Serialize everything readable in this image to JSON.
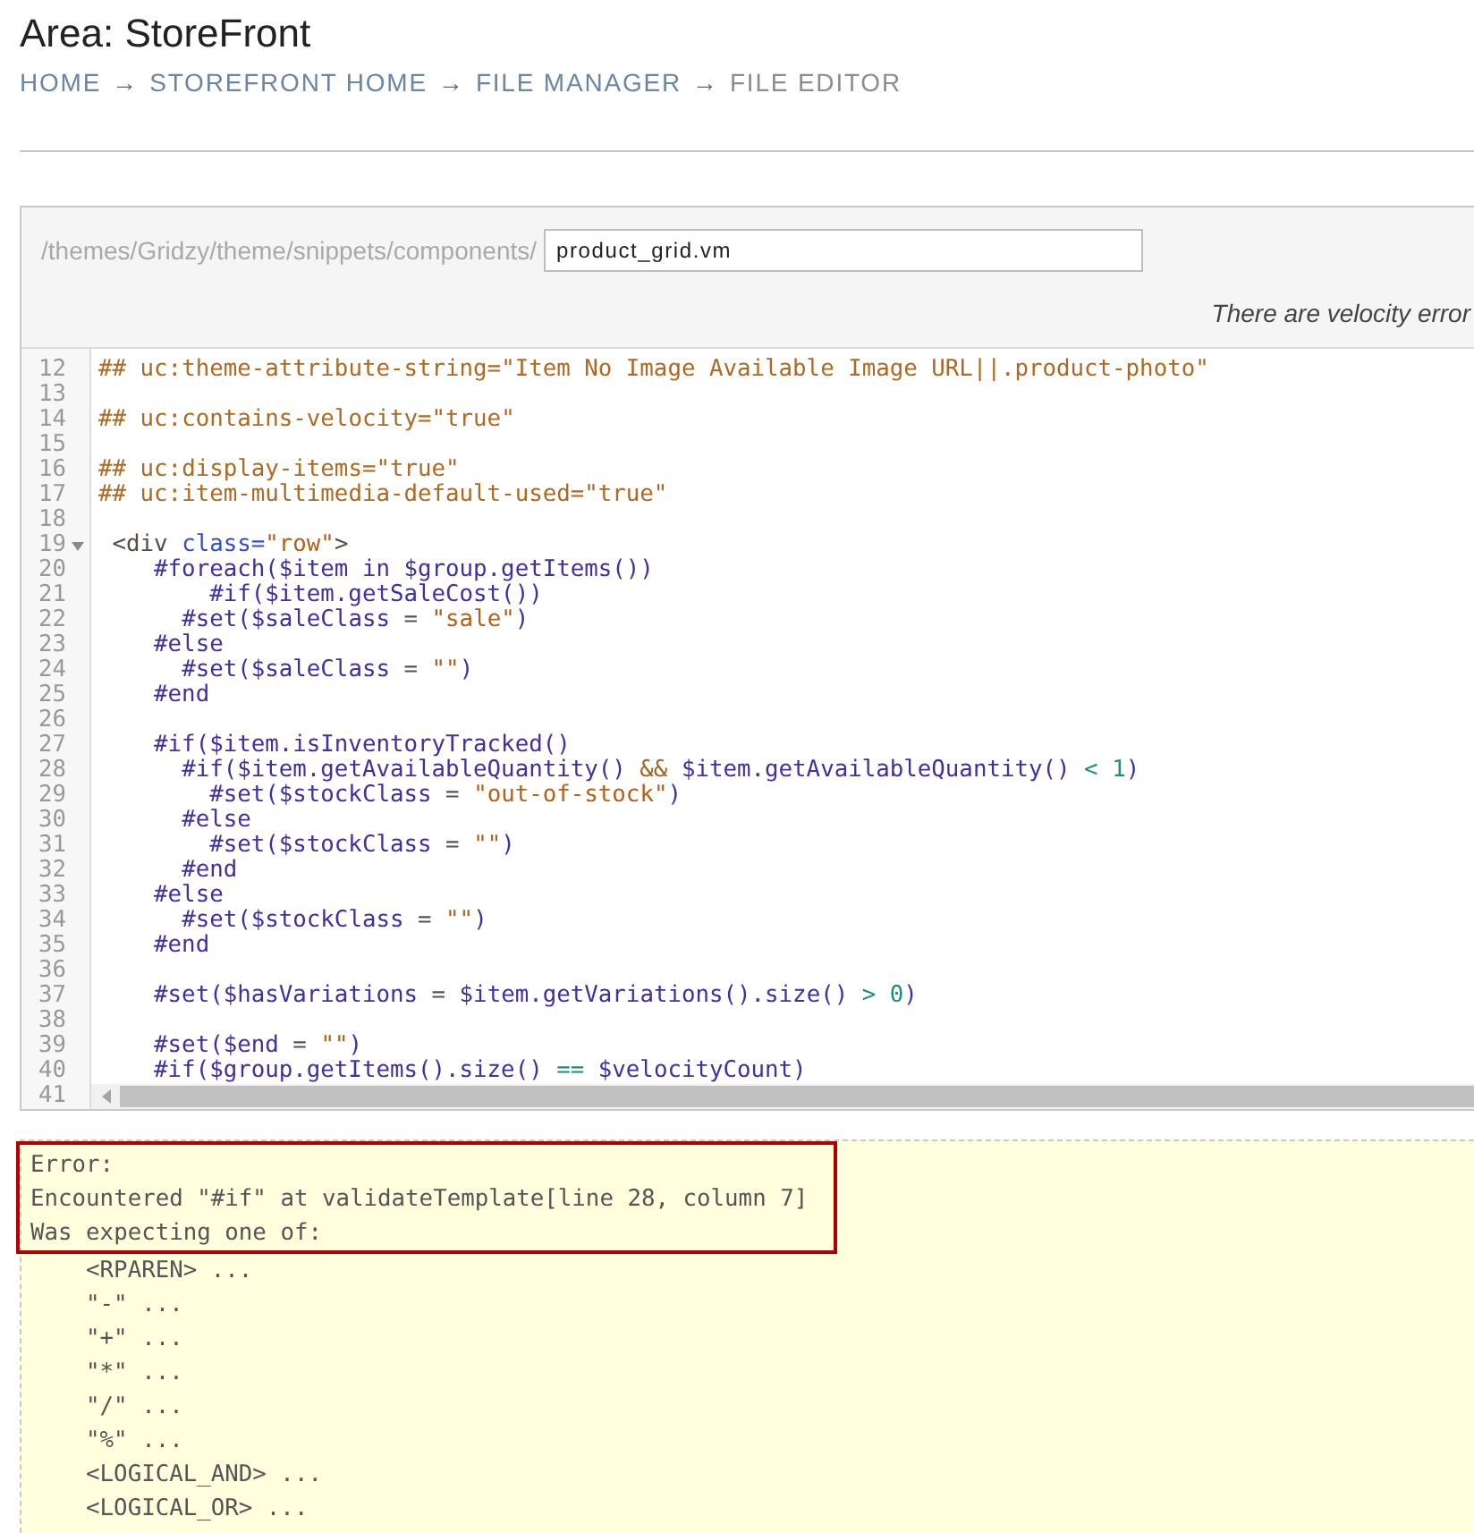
{
  "header": {
    "title": "Area: StoreFront"
  },
  "breadcrumb": [
    {
      "kind": "link",
      "label": "HOME"
    },
    {
      "kind": "separator",
      "label": "→"
    },
    {
      "kind": "link",
      "label": "STOREFRONT HOME"
    },
    {
      "kind": "separator",
      "label": "→"
    },
    {
      "kind": "link",
      "label": "FILE MANAGER"
    },
    {
      "kind": "separator",
      "label": "→"
    },
    {
      "kind": "current",
      "label": "FILE EDITOR"
    }
  ],
  "file": {
    "path": "/themes/Gridzy/theme/snippets/components/",
    "filename": "product_grid.vm",
    "status": "There are velocity error"
  },
  "editor": {
    "lines": [
      {
        "number": "12",
        "code": "## uc:theme-attribute-string=\"Item No Image Available Image URL||.product-photo\"",
        "fold": false
      },
      {
        "number": "13",
        "fold": false
      },
      {
        "number": "14",
        "code": "## uc:contains-velocity=\"true\"",
        "fold": false
      },
      {
        "number": "15",
        "fold": false
      },
      {
        "number": "16",
        "code": "## uc:display-items=\"true\"",
        "fold": false
      },
      {
        "number": "17",
        "code": "## uc:item-multimedia-default-used=\"true\"",
        "fold": false
      },
      {
        "number": "18",
        "fold": false
      },
      {
        "number": "19",
        "code": " <div class=\"row\">",
        "fold": true
      },
      {
        "number": "20",
        "code": "    #foreach($item in $group.getItems())",
        "fold": false
      },
      {
        "number": "21",
        "code": "        #if($item.getSaleCost())",
        "fold": false
      },
      {
        "number": "22",
        "code": "      #set($saleClass = \"sale\")",
        "fold": false
      },
      {
        "number": "23",
        "code": "    #else",
        "fold": false
      },
      {
        "number": "24",
        "code": "      #set($saleClass = \"\")",
        "fold": false
      },
      {
        "number": "25",
        "code": "    #end",
        "fold": false
      },
      {
        "number": "26",
        "fold": false
      },
      {
        "number": "27",
        "code": "    #if($item.isInventoryTracked()",
        "fold": false
      },
      {
        "number": "28",
        "code": "      #if($item.getAvailableQuantity() && $item.getAvailableQuantity() < 1)",
        "fold": false
      },
      {
        "number": "29",
        "code": "        #set($stockClass = \"out-of-stock\")",
        "fold": false
      },
      {
        "number": "30",
        "code": "      #else",
        "fold": false
      },
      {
        "number": "31",
        "code": "        #set($stockClass = \"\")",
        "fold": false
      },
      {
        "number": "32",
        "code": "      #end",
        "fold": false
      },
      {
        "number": "33",
        "code": "    #else",
        "fold": false
      },
      {
        "number": "34",
        "code": "      #set($stockClass = \"\")",
        "fold": false
      },
      {
        "number": "35",
        "code": "    #end",
        "fold": false
      },
      {
        "number": "36",
        "fold": false
      },
      {
        "number": "37",
        "code": "    #set($hasVariations = $item.getVariations().size() > 0)",
        "fold": false
      },
      {
        "number": "38",
        "fold": false
      },
      {
        "number": "39",
        "code": "    #set($end = \"\")",
        "fold": false
      },
      {
        "number": "40",
        "code": "    #if($group.getItems().size() == $velocityCount)",
        "fold": false
      },
      {
        "number": "41",
        "fold": false
      }
    ]
  },
  "error_output": {
    "lines": [
      {
        "text": "Error:",
        "highlighted": true
      },
      {
        "text": "Encountered \"#if\" at validateTemplate[line 28, column 7]",
        "highlighted": true
      },
      {
        "text": "Was expecting one of:",
        "highlighted": true
      },
      {
        "text": "    <RPAREN> ...",
        "highlighted": false
      },
      {
        "text": "    \"-\" ...",
        "highlighted": false
      },
      {
        "text": "    \"+\" ...",
        "highlighted": false
      },
      {
        "text": "    \"*\" ...",
        "highlighted": false
      },
      {
        "text": "    \"/\" ...",
        "highlighted": false
      },
      {
        "text": "    \"%\" ...",
        "highlighted": false
      },
      {
        "text": "    <LOGICAL_AND> ...",
        "highlighted": false
      },
      {
        "text": "    <LOGICAL_OR> ...",
        "highlighted": false
      }
    ]
  }
}
